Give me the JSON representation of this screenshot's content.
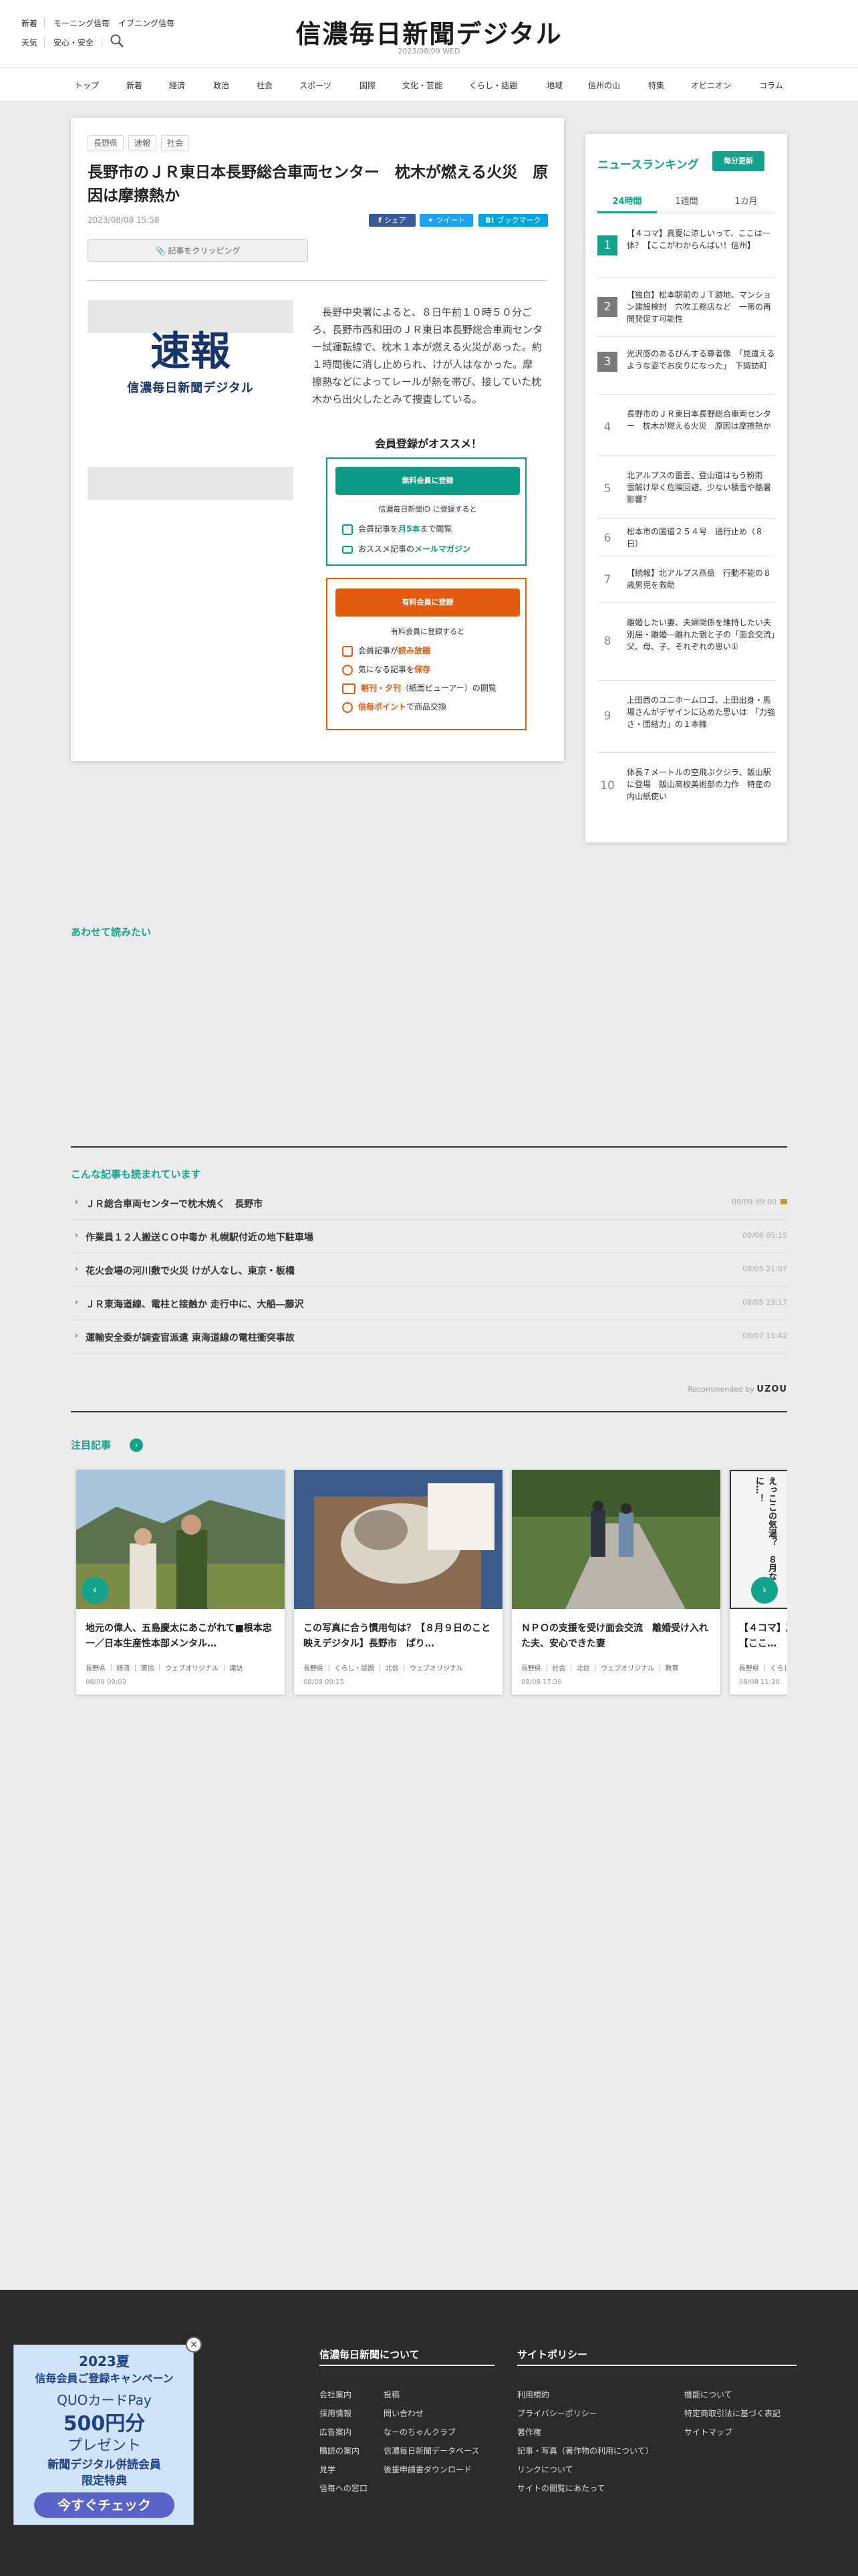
{
  "header": {
    "links_row1": [
      "新着",
      "モーニング信毎",
      "イブニング信毎"
    ],
    "links_row2": [
      "天気",
      "安心・安全"
    ],
    "logo": "信濃毎日新聞デジタル",
    "date": "2023/08/09 WED"
  },
  "nav": [
    "トップ",
    "新着",
    "経済",
    "政治",
    "社会",
    "スポーツ",
    "国際",
    "文化・芸能",
    "くらし・話題",
    "地域",
    "信州の山",
    "特集",
    "オピニオン",
    "コラム"
  ],
  "article": {
    "tags": [
      "長野県",
      "速報",
      "社会"
    ],
    "title": "長野市のＪＲ東日本長野総合車両センター　枕木が燃える火災　原因は摩擦熱か",
    "date": "2023/08/08 15:58",
    "share": {
      "facebook": "シェア",
      "twitter": "ツイート",
      "hatena": "ブックマーク"
    },
    "clip_label": "記事をクリッピング",
    "sokuho": "速報",
    "sokuho_sub": "信濃毎日新聞デジタル",
    "body": "長野中央署によると、８日午前１０時５０分ごろ、長野市西和田のＪＲ東日本長野総合車両センター試運転線で、枕木１本が燃える火災があった。約１時間後に消し止められ、けが人はなかった。摩擦熱などによってレールが熱を帯び、接していた枕木から出火したとみて捜査している。",
    "register_title": "会員登録がオススメ！",
    "free": {
      "button": "無料会員に登録",
      "sub": "信濃毎日新聞ID に登録すると",
      "rows": [
        {
          "pre": "会員記事を",
          "hl": "月5本",
          "post": "まで閲覧"
        },
        {
          "pre": "おススメ記事の",
          "hl": "メールマガジン",
          "post": ""
        }
      ]
    },
    "paid": {
      "button": "有料会員に登録",
      "sub": "有料会員に登録すると",
      "rows": [
        {
          "pre": "会員記事が",
          "hl": "読み放題",
          "post": ""
        },
        {
          "pre": "気になる記事を",
          "hl": "保存",
          "post": ""
        },
        {
          "pre": "",
          "hl": "朝刊・夕刊",
          "post": "（紙面ビューアー）の閲覧"
        },
        {
          "pre": "",
          "hl": "信毎ポイント",
          "post": "で商品交換"
        }
      ]
    }
  },
  "ranking": {
    "title": "ニュースランキング",
    "badge": "毎分更新",
    "tabs": [
      "24時間",
      "1週間",
      "1カ月"
    ],
    "items": [
      {
        "rank": "1",
        "text": "【４コマ】真夏に涼しいって、ここは一体？【ここがわからんばい！信州】"
      },
      {
        "rank": "2",
        "text": "【独自】松本駅前のＪＴ跡地、マンション建設検討　穴吹工務店など　一帯の再開発促す可能性"
      },
      {
        "rank": "3",
        "text": "光沢感のあるびんする尊者像　「見違えるような姿でお戻りになった」　下諏訪町"
      },
      {
        "rank": "4",
        "text": "長野市のＪＲ東日本長野総合車両センター　枕木が燃える火災　原因は摩擦熱か"
      },
      {
        "rank": "5",
        "text": "北アルプスの雷雲、登山道はもう粉雨　雪解け早く危険回避、少ない積雪や酷暑影響？"
      },
      {
        "rank": "6",
        "text": "松本市の国道２５４号　通行止め（８日）"
      },
      {
        "rank": "7",
        "text": "【続報】北アルプス燕岳　行動不能の８歳男児を救助"
      },
      {
        "rank": "8",
        "text": "離婚したい妻、夫婦関係を維持したい夫　別居・離婚―離れた親と子の「面会交流」　父、母、子、それぞれの思い①"
      },
      {
        "rank": "9",
        "text": "上田西のユニホームロゴ、上田出身・馬場さんがデザインに込めた思いは　「力強さ・団結力」の１本線"
      },
      {
        "rank": "10",
        "text": "体長７メートルの空飛ぶクジラ、飯山駅に登場　飯山高校美術部の力作　特産の内山紙使い"
      }
    ]
  },
  "also_read": "あわせて読みたい",
  "read_more": {
    "title": "こんな記事も読まれています",
    "items": [
      {
        "title": "ＪＲ総合車両センターで枕木焼く　長野市",
        "date": "08/09 09:00",
        "locked": true
      },
      {
        "title": "作業員１２人搬送ＣＯ中毒か 札幌駅付近の地下駐車場",
        "date": "08/08 05:15",
        "locked": false
      },
      {
        "title": "花火会場の河川敷で火災 けが人なし、東京・板橋",
        "date": "08/05 21:07",
        "locked": false
      },
      {
        "title": "ＪＲ東海道線、電柱と接触か 走行中に、大船―藤沢",
        "date": "08/05 23:17",
        "locked": false
      },
      {
        "title": "運輸安全委が調査官派遣 東海道線の電柱衝突事故",
        "date": "08/07 15:42",
        "locked": false
      }
    ],
    "recommended_by": "Recommended by",
    "recommended_brand": "UZOU"
  },
  "featured": {
    "title": "注目記事",
    "cards": [
      {
        "title": "地元の偉人、五島慶太にあこがれて■根本忠一／日本生産性本部メンタル…",
        "cats": "長野県 ｜ 経済 ｜ 東信 ｜ ウェブオリジナル ｜ 諏訪",
        "date": "08/09 09:03"
      },
      {
        "title": "この写真に合う慣用句は？【８月９日のこと映えデジタル】長野市　ぱり…",
        "cats": "長野県 ｜ くらし・話題 ｜ 北信 ｜ ウェブオリジナル",
        "date": "08/09 00:15"
      },
      {
        "title": "ＮＰＯの支援を受け面会交流　離婚受け入れた夫、安心できた妻",
        "cats": "長野県 ｜ 社会 ｜ 北信 ｜ ウェブオリジナル ｜ 教育",
        "date": "08/08 17:30"
      },
      {
        "title": "【４コマ】真夏に涼しいって、ここは一体？【ここ…",
        "cats": "長野県 ｜ くらし",
        "date": "08/08 11:30"
      }
    ],
    "comic_text": "えっここの気温？　８月なのに…！"
  },
  "footer": {
    "col1_title": "信濃毎日新聞について",
    "col1_a": [
      "会社案内",
      "採用情報",
      "広告案内",
      "購読の案内",
      "見学",
      "信毎への窓口"
    ],
    "col1_b": [
      "投稿",
      "問い合わせ",
      "なーのちゃんクラブ",
      "信濃毎日新聞データベース",
      "後援申請書ダウンロード"
    ],
    "col2_title": "サイトポリシー",
    "col2_a": [
      "利用規約",
      "プライバシーポリシー",
      "著作権",
      "記事・写真（著作物の利用について）",
      "リンクについて",
      "サイトの閲覧にあたって"
    ],
    "col2_b": [
      "機能について",
      "特定商取引法に基づく表記",
      "サイトマップ"
    ]
  },
  "banner": {
    "line1": "2023夏",
    "line2": "信毎会員ご登録キャンペーン",
    "line3": "QUOカードPay",
    "line4": "500円分",
    "line5": "プレゼント",
    "line6": "新聞デジタル併読会員",
    "line7": "限定特典",
    "button": "今すぐチェック"
  },
  "colors": {
    "accent": "#13a38c",
    "free": "#0c9c85",
    "paid": "#e25b10",
    "facebook": "#3b5998",
    "twitter": "#1da1f2",
    "hatena": "#00a4de"
  }
}
